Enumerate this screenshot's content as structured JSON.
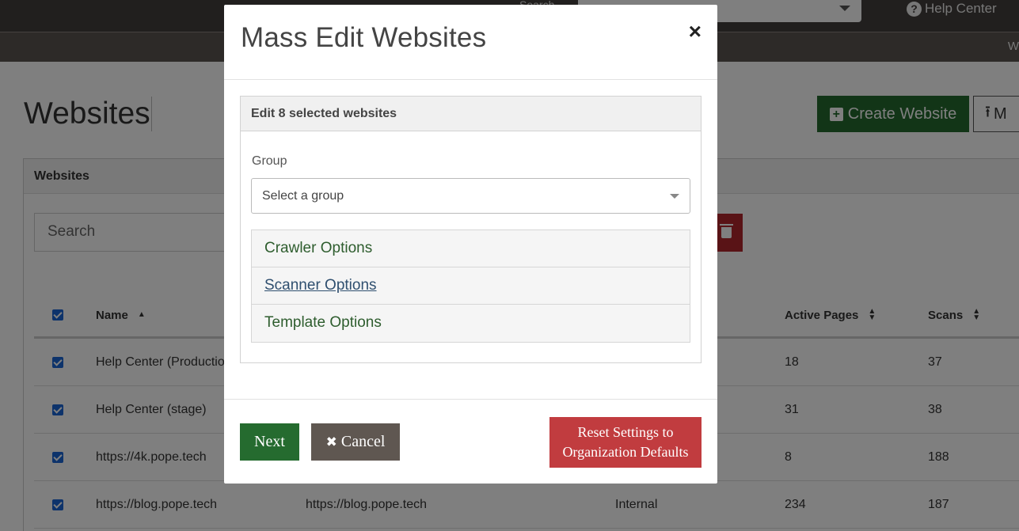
{
  "topbar": {
    "search_label": "Search",
    "help_label": "Help Center",
    "help_icon": "question-circle-icon",
    "subbar_letter": "W"
  },
  "page": {
    "title": "Websites",
    "create_button": "Create Website",
    "upload_button": "M",
    "panel_title": "Websites",
    "search_placeholder": "Search"
  },
  "table": {
    "columns": {
      "name": "Name",
      "active_pages": "Active Pages",
      "scans": "Scans"
    },
    "rows": [
      {
        "name": "Help Center (Production)",
        "url": "",
        "type": "",
        "active_pages": "18",
        "scans": "37"
      },
      {
        "name": "Help Center (stage)",
        "url": "",
        "type": "",
        "active_pages": "31",
        "scans": "38"
      },
      {
        "name": "https://4k.pope.tech",
        "url": "",
        "type": "",
        "active_pages": "8",
        "scans": "188"
      },
      {
        "name": "https://blog.pope.tech",
        "url": "https://blog.pope.tech",
        "type": "Internal",
        "active_pages": "234",
        "scans": "187"
      }
    ]
  },
  "modal": {
    "title": "Mass Edit Websites",
    "close_symbol": "×",
    "card_header": "Edit 8 selected websites",
    "group_label": "Group",
    "group_placeholder": "Select a group",
    "accordion": [
      "Crawler Options",
      "Scanner Options",
      "Template Options"
    ],
    "next_button": "Next",
    "cancel_button": "Cancel",
    "reset_button_line1": "Reset Settings to",
    "reset_button_line2": "Organization Defaults"
  },
  "colors": {
    "primary_green": "#256b2f",
    "danger_red": "#c13c3f",
    "cancel_gray": "#5f5751",
    "checkbox_blue": "#1a66d6"
  }
}
